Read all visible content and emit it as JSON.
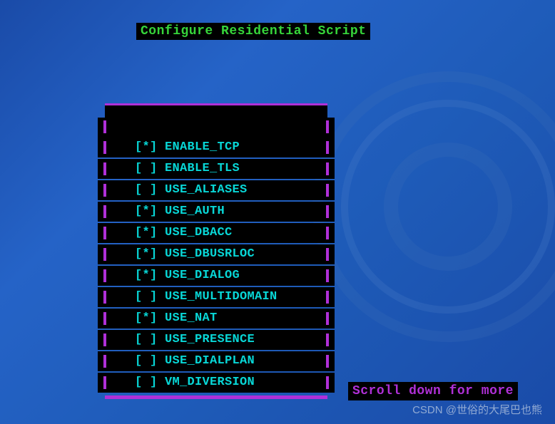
{
  "title": "Configure Residential Script",
  "menu": {
    "items": [
      {
        "checked": true,
        "label": "ENABLE_TCP"
      },
      {
        "checked": false,
        "label": "ENABLE_TLS"
      },
      {
        "checked": false,
        "label": "USE_ALIASES"
      },
      {
        "checked": true,
        "label": "USE_AUTH"
      },
      {
        "checked": true,
        "label": "USE_DBACC"
      },
      {
        "checked": true,
        "label": "USE_DBUSRLOC"
      },
      {
        "checked": true,
        "label": "USE_DIALOG"
      },
      {
        "checked": false,
        "label": "USE_MULTIDOMAIN"
      },
      {
        "checked": true,
        "label": "USE_NAT"
      },
      {
        "checked": false,
        "label": "USE_PRESENCE"
      },
      {
        "checked": false,
        "label": "USE_DIALPLAN"
      },
      {
        "checked": false,
        "label": "VM_DIVERSION"
      }
    ]
  },
  "scroll_hint": "Scroll down for more",
  "watermark": "CSDN @世俗的大尾巴也熊",
  "colors": {
    "title_fg": "#36d53a",
    "menu_fg": "#08d6d6",
    "accent": "#b030d8",
    "bg_black": "#000000"
  }
}
